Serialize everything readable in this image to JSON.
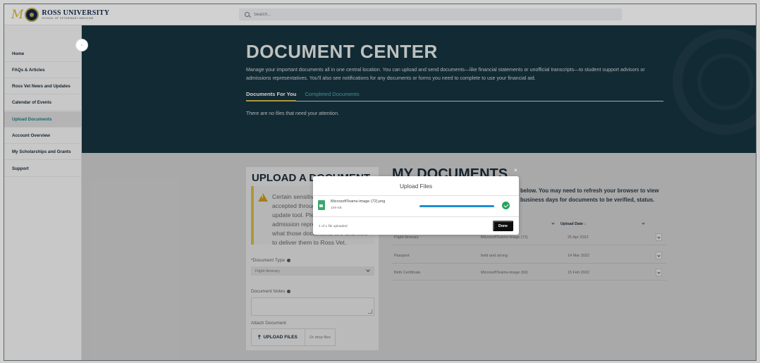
{
  "header": {
    "logo_mark": "M",
    "logo_title": "ROSS UNIVERSITY",
    "logo_subtitle": "SCHOOL OF VETERINARY MEDICINE",
    "search_placeholder": "Search..."
  },
  "sidebar": {
    "items": [
      {
        "label": "Home"
      },
      {
        "label": "FAQs & Articles"
      },
      {
        "label": "Ross Vet News and Updates"
      },
      {
        "label": "Calendar of Events"
      },
      {
        "label": "Upload Documents"
      },
      {
        "label": "Account Overview"
      },
      {
        "label": "My Scholarships and Grants"
      },
      {
        "label": "Support"
      }
    ]
  },
  "hero": {
    "title": "DOCUMENT CENTER",
    "description": "Manage your important documents all in one central location. You can upload and send documents—like financial statements or unofficial transcripts—to student support advisors or admissions representatives. You'll also see notifications for any documents or forms you need to complete to use your financial aid.",
    "tabs": [
      {
        "label": "Documents For You"
      },
      {
        "label": "Completed Documents"
      }
    ],
    "empty_message": "There are no files that need your attention."
  },
  "upload": {
    "title": "UPLOAD A DOCUMENT",
    "warning": "Certain sensitive documents can't be accepted through the document update tool. Please contact your admission representative to confirm what those documents are and how to deliver them to Ross Vet.",
    "document_type_label": "*Document Type",
    "document_type_value": "Flight Itinerary",
    "notes_label": "Document Notes",
    "attach_label": "Attach Document",
    "upload_button": "UPLOAD FILES",
    "drop_text": "Or drop files"
  },
  "my_documents": {
    "title": "MY DOCUMENTS",
    "description": "below. You may need to refresh your browser to view business days for documents to be verified, status.",
    "header_date": "Upload Date ↓",
    "rows": [
      {
        "type": "Flight Itinerary",
        "notes": "MicrosoftTeams-image (72)",
        "date": "25 Apr 2022"
      },
      {
        "type": "Passport",
        "notes": "bold and strong",
        "date": "14 Mar 2022"
      },
      {
        "type": "Birth Certificate",
        "notes": "MicrosoftTeams-image (60)",
        "date": "15 Feb 2022"
      }
    ]
  },
  "modal": {
    "title": "Upload Files",
    "close_glyph": "×",
    "file_name": "MicrosoftTeams-image (72).png",
    "file_size": "109 KB",
    "progress": 1.0,
    "status": "1 of 1 file uploaded",
    "done_button": "Done"
  },
  "colors": {
    "hero_bg": "#173440",
    "accent_gold": "#d5b84a",
    "accent_teal": "#1a7f86",
    "progress_blue": "#1b8fd6",
    "success_green": "#26a35b"
  }
}
